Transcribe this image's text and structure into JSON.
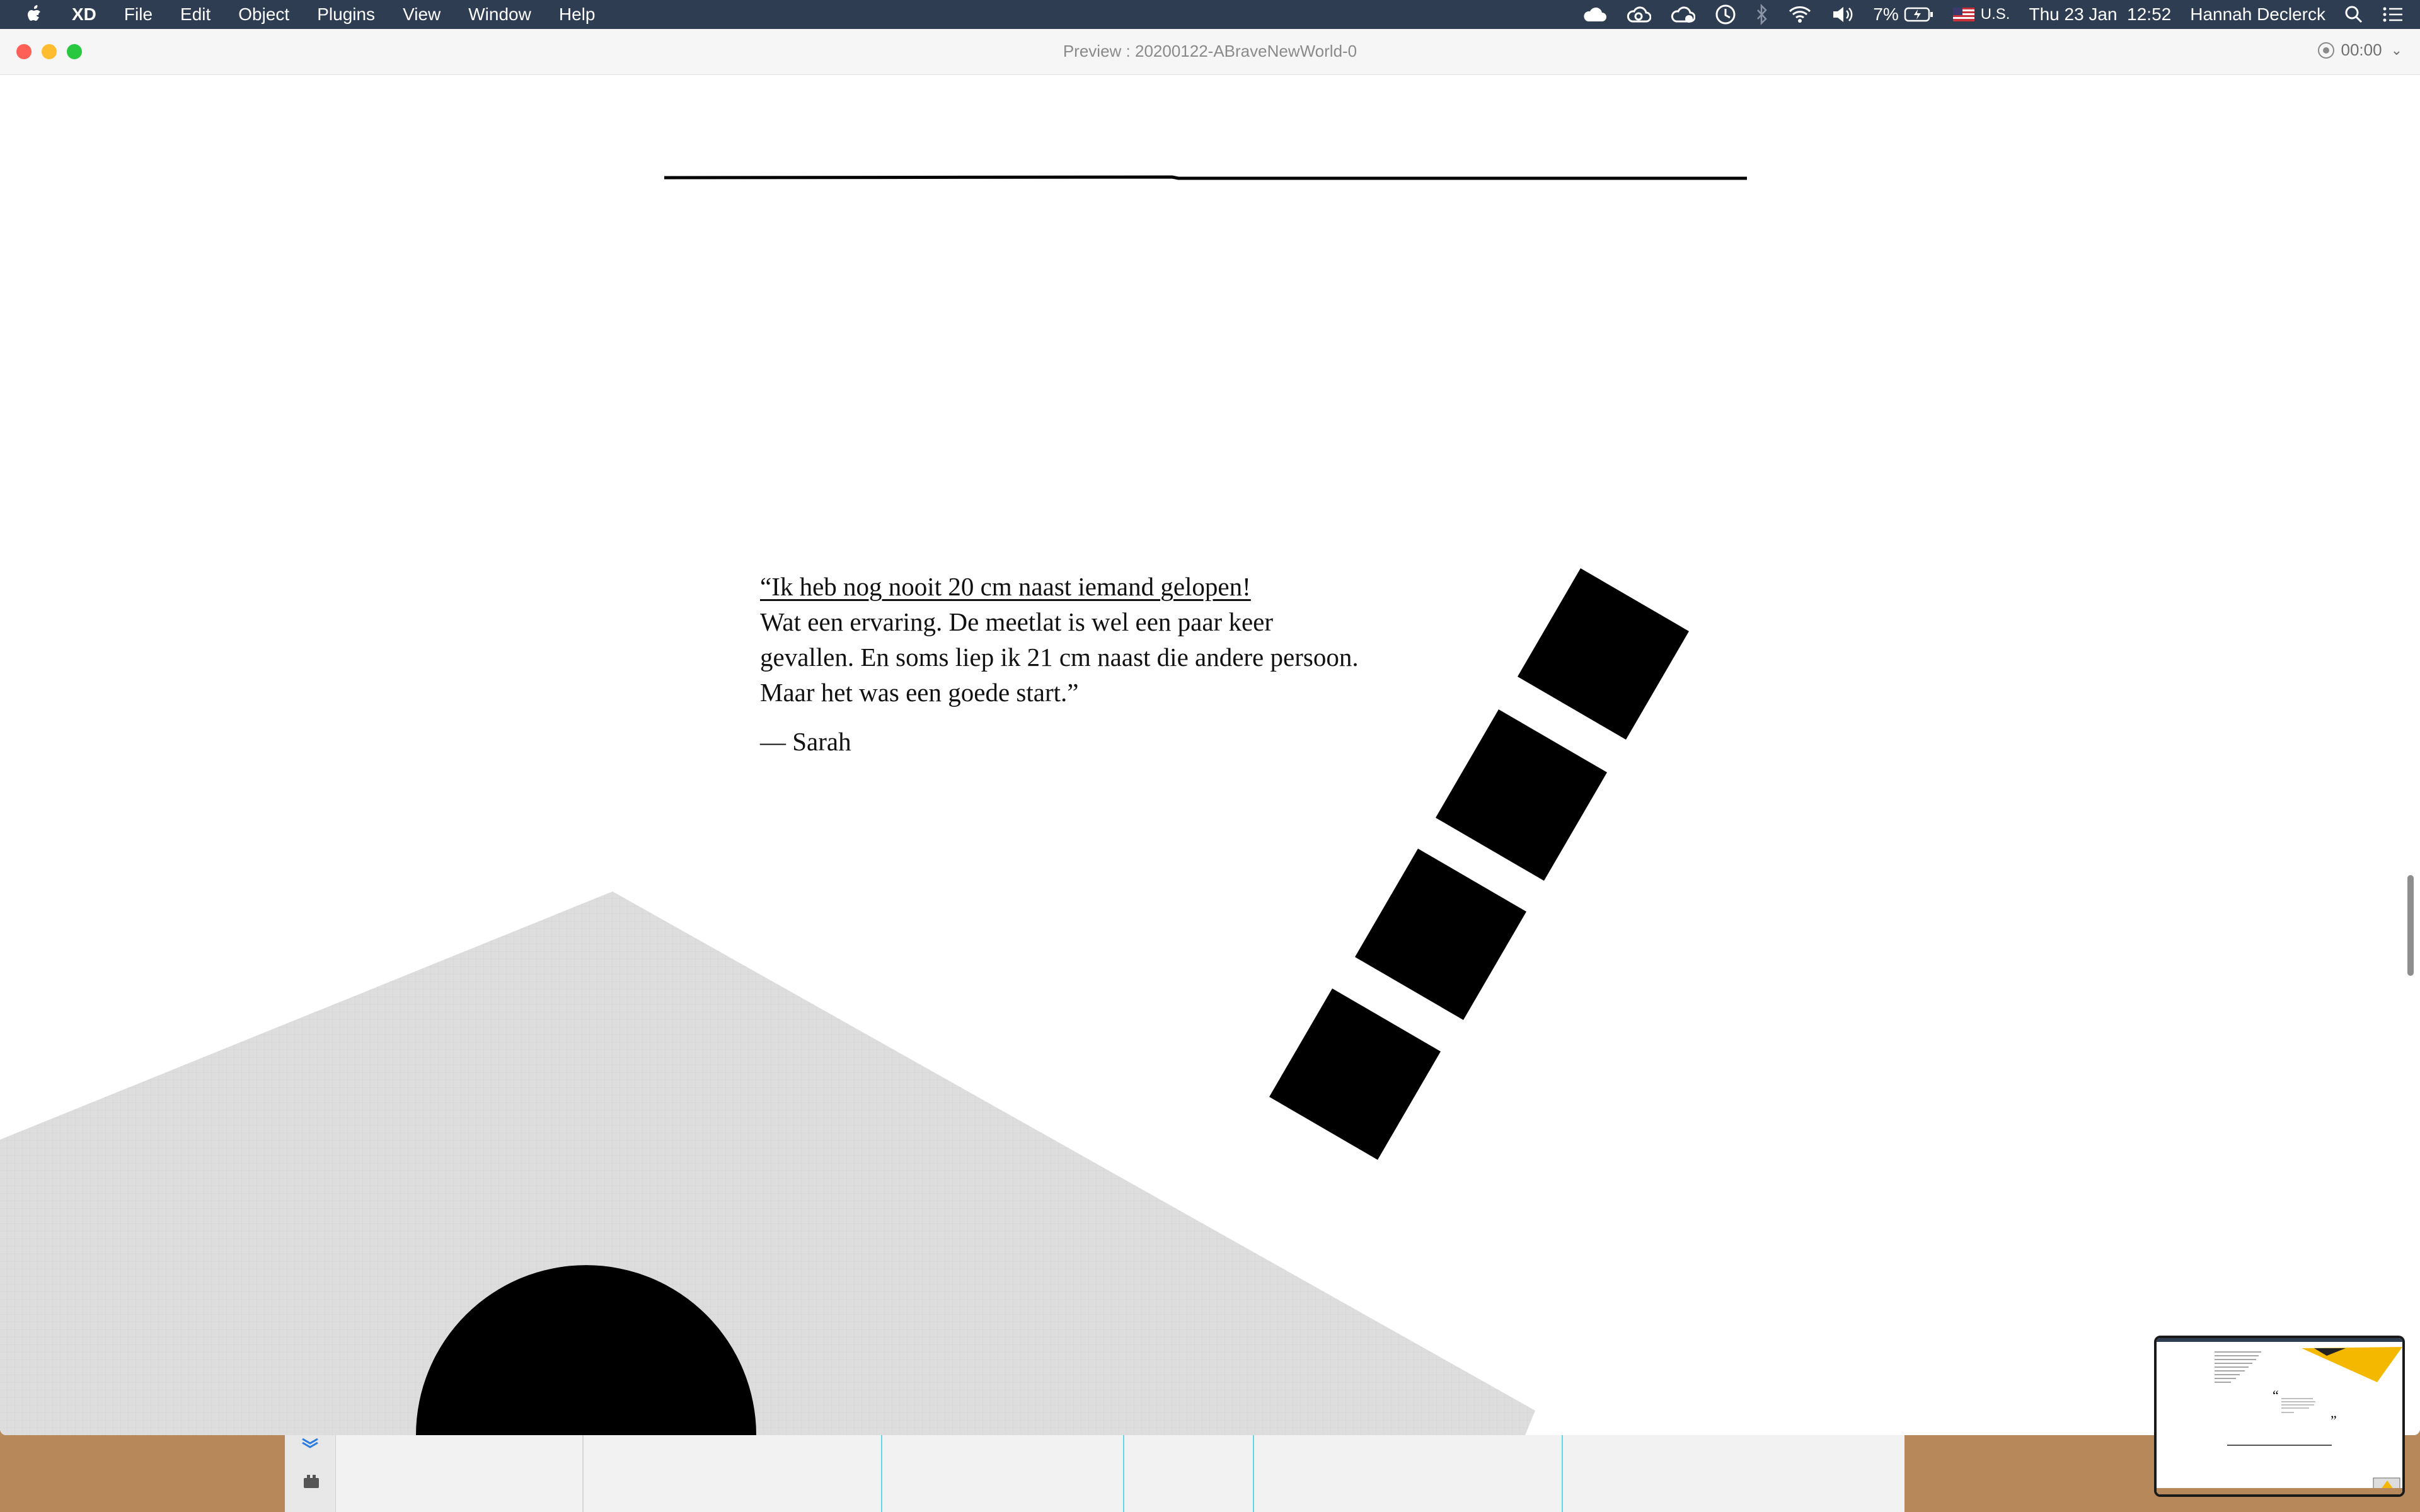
{
  "menubar": {
    "app_name": "XD",
    "menu_items": [
      "File",
      "Edit",
      "Object",
      "Plugins",
      "View",
      "Window",
      "Help"
    ],
    "status": {
      "battery": "7%",
      "input_source": "U.S.",
      "datetime": "Thu 23 Jan  12:52",
      "user": "Hannah Declerck"
    },
    "icons": [
      "creative-cloud-icon",
      "sync-icon",
      "cloud-icon",
      "time-machine-icon",
      "bluetooth-icon",
      "wifi-icon",
      "volume-icon",
      "battery-icon",
      "flag-icon",
      "spotlight-icon",
      "notification-center-icon"
    ]
  },
  "window": {
    "title": "Preview : 20200122-ABraveNewWorld-0",
    "recording_time": "00:00"
  },
  "content": {
    "quote_lines": [
      "“Ik heb nog nooit 20 cm naast iemand gelopen!",
      "Wat een ervaring. De meetlat is wel een paar keer",
      "gevallen. En soms liep ik 21 cm naast die andere persoon.",
      "Maar het was een goede start.”"
    ],
    "author": "— Sarah"
  },
  "colors": {
    "menubar_bg": "#2f3d52",
    "shape_black": "#000000",
    "triangle_grey": "#dedede",
    "desktop": "#b7895a",
    "thumbnail_accent": "#f5b800"
  }
}
